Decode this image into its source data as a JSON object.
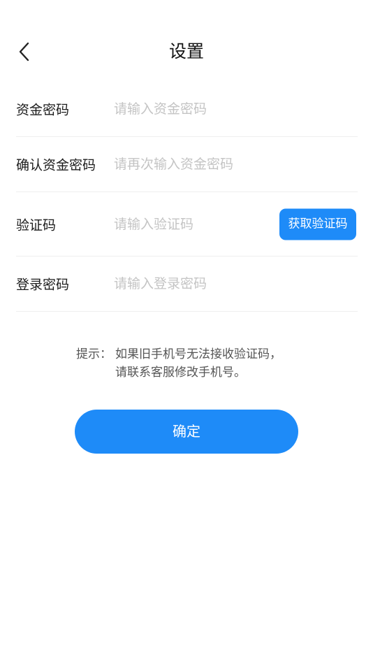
{
  "header": {
    "title": "设置",
    "back_icon": "chevron-left-icon"
  },
  "form": {
    "fields": [
      {
        "label": "资金密码",
        "placeholder": "请输入资金密码",
        "value": ""
      },
      {
        "label": "确认资金密码",
        "placeholder": "请再次输入资金密码",
        "value": ""
      },
      {
        "label": "验证码",
        "placeholder": "请输入验证码",
        "value": "",
        "action_label": "获取验证码"
      },
      {
        "label": "登录密码",
        "placeholder": "请输入登录密码",
        "value": ""
      }
    ]
  },
  "tip": {
    "prefix": "提示：",
    "lines": [
      "如果旧手机号无法接收验证码，",
      "请联系客服修改手机号。"
    ]
  },
  "confirm": {
    "label": "确定"
  },
  "colors": {
    "accent": "#1e8bf8",
    "placeholder": "#c4c4c4",
    "divider": "#eeeeee"
  }
}
